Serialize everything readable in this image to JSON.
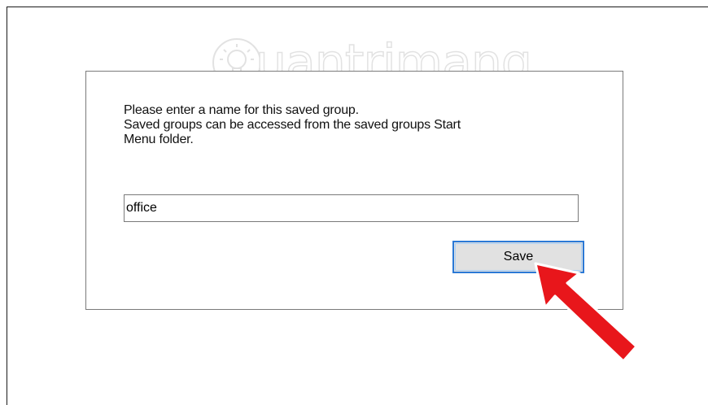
{
  "dialog": {
    "message_lines": [
      "Please enter a name for this saved group.",
      "Saved groups can be accessed from the saved groups Start",
      "Menu folder."
    ],
    "name_value": "office",
    "save_label": "Save"
  },
  "watermark": {
    "text": "uantrimang"
  },
  "colors": {
    "button_focus_border": "#2b79d6",
    "button_face": "#e1e1e1",
    "annotation_arrow": "#e8161b"
  },
  "icons": {
    "watermark_logo": "lightbulb-icon",
    "annotation": "red-arrow-icon"
  }
}
